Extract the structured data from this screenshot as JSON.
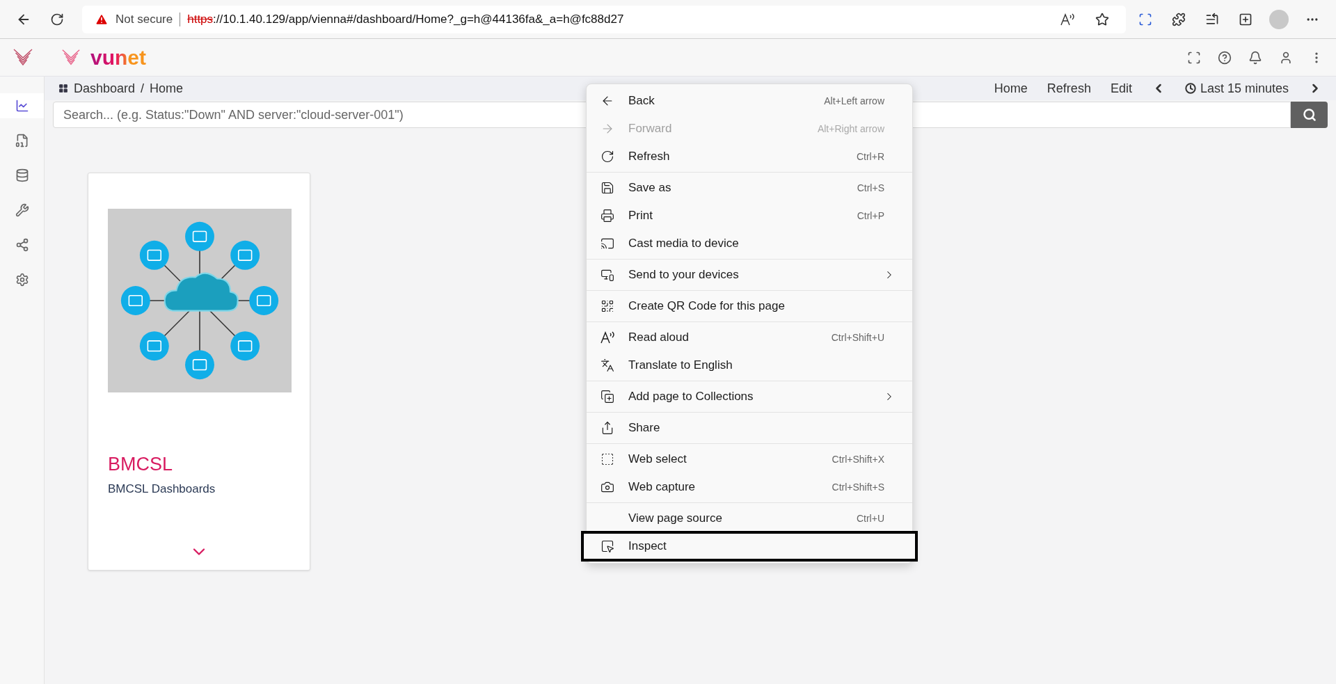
{
  "browser": {
    "security_label": "Not secure",
    "url_scheme": "https",
    "url_rest": "://10.1.40.129/app/vienna#/dashboard/Home?_g=h@44136fa&_a=h@fc88d27"
  },
  "app": {
    "logo_text": "vunet"
  },
  "sidebar": {
    "items": [
      {
        "selected": true
      },
      {
        "selected": false
      },
      {
        "selected": false
      },
      {
        "selected": false
      },
      {
        "selected": false
      },
      {
        "selected": false
      }
    ]
  },
  "breadcrumb": [
    "Dashboard",
    "Home"
  ],
  "breadcrumb_separator": "/",
  "toolbar": {
    "links": [
      "Home",
      "Refresh",
      "Edit"
    ],
    "time_range": "Last 15 minutes"
  },
  "search": {
    "placeholder": "Search... (e.g. Status:\"Down\" AND server:\"cloud-server-001\")"
  },
  "cards": [
    {
      "title": "BMCSL",
      "subtitle": "BMCSL Dashboards"
    }
  ],
  "context_menu": {
    "groups": [
      [
        {
          "label": "Back",
          "shortcut": "Alt+Left arrow",
          "disabled": false,
          "submenu": false,
          "outlined": false
        },
        {
          "label": "Forward",
          "shortcut": "Alt+Right arrow",
          "disabled": true,
          "submenu": false,
          "outlined": false
        },
        {
          "label": "Refresh",
          "shortcut": "Ctrl+R",
          "disabled": false,
          "submenu": false,
          "outlined": false
        }
      ],
      [
        {
          "label": "Save as",
          "shortcut": "Ctrl+S",
          "disabled": false,
          "submenu": false,
          "outlined": false
        },
        {
          "label": "Print",
          "shortcut": "Ctrl+P",
          "disabled": false,
          "submenu": false,
          "outlined": false
        },
        {
          "label": "Cast media to device",
          "disabled": false,
          "submenu": false,
          "outlined": false
        }
      ],
      [
        {
          "label": "Send to your devices",
          "disabled": false,
          "submenu": true,
          "outlined": false
        }
      ],
      [
        {
          "label": "Create QR Code for this page",
          "disabled": false,
          "submenu": false,
          "outlined": false
        }
      ],
      [
        {
          "label": "Read aloud",
          "shortcut": "Ctrl+Shift+U",
          "disabled": false,
          "submenu": false,
          "outlined": false
        },
        {
          "label": "Translate to English",
          "disabled": false,
          "submenu": false,
          "outlined": false
        }
      ],
      [
        {
          "label": "Add page to Collections",
          "disabled": false,
          "submenu": true,
          "outlined": false
        }
      ],
      [
        {
          "label": "Share",
          "disabled": false,
          "submenu": false,
          "outlined": false
        }
      ],
      [
        {
          "label": "Web select",
          "shortcut": "Ctrl+Shift+X",
          "disabled": false,
          "submenu": false,
          "outlined": false
        },
        {
          "label": "Web capture",
          "shortcut": "Ctrl+Shift+S",
          "disabled": false,
          "submenu": false,
          "outlined": false
        }
      ],
      [
        {
          "label": "View page source",
          "shortcut": "Ctrl+U",
          "disabled": false,
          "submenu": false,
          "outlined": false
        },
        {
          "label": "Inspect",
          "disabled": false,
          "submenu": false,
          "outlined": true
        }
      ]
    ]
  }
}
